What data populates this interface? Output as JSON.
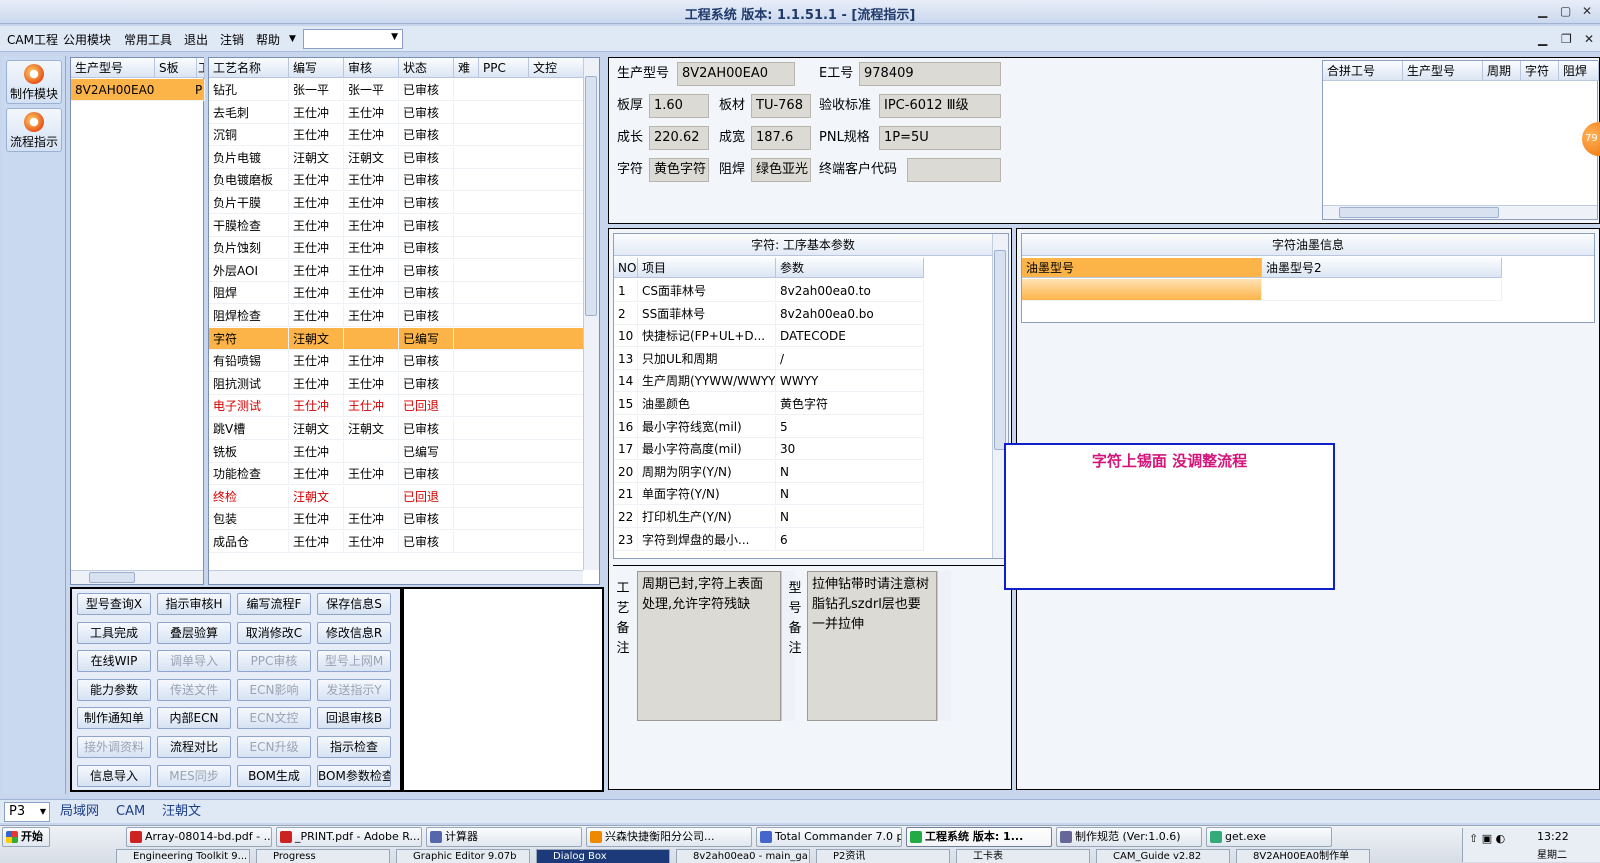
{
  "window": {
    "title": "工程系统  版本: 1.1.51.1 - [流程指示]"
  },
  "menu": {
    "items": [
      "CAM工程",
      "公用模块",
      "常用工具",
      "退出",
      "注销",
      "帮助"
    ]
  },
  "leftbar": {
    "items": [
      "制作模块",
      "流程指示"
    ]
  },
  "model_list": {
    "headers": [
      "生产型号",
      "S板",
      "工"
    ],
    "rows": [
      {
        "model": "8V2AH00EA0",
        "flag": "P"
      }
    ]
  },
  "process": {
    "headers": [
      "工艺名称",
      "编写",
      "审核",
      "状态",
      "难",
      "PPC",
      "文控"
    ],
    "rows": [
      {
        "name": "钻孔",
        "writer": "张一平",
        "reviewer": "张一平",
        "status": "已审核"
      },
      {
        "name": "去毛刺",
        "writer": "王仕冲",
        "reviewer": "王仕冲",
        "status": "已审核"
      },
      {
        "name": "沉铜",
        "writer": "王仕冲",
        "reviewer": "王仕冲",
        "status": "已审核"
      },
      {
        "name": "负片电镀",
        "writer": "汪朝文",
        "reviewer": "汪朝文",
        "status": "已审核"
      },
      {
        "name": "负电镀磨板",
        "writer": "王仕冲",
        "reviewer": "王仕冲",
        "status": "已审核"
      },
      {
        "name": "负片干膜",
        "writer": "王仕冲",
        "reviewer": "王仕冲",
        "status": "已审核"
      },
      {
        "name": "干膜检查",
        "writer": "王仕冲",
        "reviewer": "王仕冲",
        "status": "已审核"
      },
      {
        "name": "负片蚀刻",
        "writer": "王仕冲",
        "reviewer": "王仕冲",
        "status": "已审核"
      },
      {
        "name": "外层AOI",
        "writer": "王仕冲",
        "reviewer": "王仕冲",
        "status": "已审核"
      },
      {
        "name": "阻焊",
        "writer": "王仕冲",
        "reviewer": "王仕冲",
        "status": "已审核"
      },
      {
        "name": "阻焊检查",
        "writer": "王仕冲",
        "reviewer": "王仕冲",
        "status": "已审核"
      },
      {
        "name": "字符",
        "writer": "汪朝文",
        "reviewer": "",
        "status": "已编写"
      },
      {
        "name": "有铅喷锡",
        "writer": "王仕冲",
        "reviewer": "王仕冲",
        "status": "已审核"
      },
      {
        "name": "阻抗测试",
        "writer": "王仕冲",
        "reviewer": "王仕冲",
        "status": "已审核"
      },
      {
        "name": "电子测试",
        "writer": "王仕冲",
        "reviewer": "王仕冲",
        "status": "已回退"
      },
      {
        "name": "跳V槽",
        "writer": "汪朝文",
        "reviewer": "汪朝文",
        "status": "已审核"
      },
      {
        "name": "铣板",
        "writer": "王仕冲",
        "reviewer": "",
        "status": "已编写"
      },
      {
        "name": "功能检查",
        "writer": "王仕冲",
        "reviewer": "王仕冲",
        "status": "已审核"
      },
      {
        "name": "终检",
        "writer": "汪朝文",
        "reviewer": "",
        "status": "已回退"
      },
      {
        "name": "包装",
        "writer": "王仕冲",
        "reviewer": "王仕冲",
        "status": "已审核"
      },
      {
        "name": "成品仓",
        "writer": "王仕冲",
        "reviewer": "王仕冲",
        "status": "已审核"
      }
    ]
  },
  "actions": [
    [
      {
        "label": "型号查询X",
        "enabled": true
      },
      {
        "label": "指示审核H",
        "enabled": true
      },
      {
        "label": "编写流程F",
        "enabled": true
      },
      {
        "label": "保存信息S",
        "enabled": true
      }
    ],
    [
      {
        "label": "工具完成",
        "enabled": true
      },
      {
        "label": "叠层验算",
        "enabled": true
      },
      {
        "label": "取消修改C",
        "enabled": true
      },
      {
        "label": "修改信息R",
        "enabled": true
      }
    ],
    [
      {
        "label": "在线WIP",
        "enabled": true
      },
      {
        "label": "调单导入",
        "enabled": false
      },
      {
        "label": "PPC审核",
        "enabled": false
      },
      {
        "label": "型号上网M",
        "enabled": false
      }
    ],
    [
      {
        "label": "能力参数",
        "enabled": true
      },
      {
        "label": "传送文件",
        "enabled": false
      },
      {
        "label": "ECN影响",
        "enabled": false
      },
      {
        "label": "发送指示Y",
        "enabled": false
      }
    ],
    [
      {
        "label": "制作通知单",
        "enabled": true
      },
      {
        "label": "内部ECN",
        "enabled": true
      },
      {
        "label": "ECN文控",
        "enabled": false
      },
      {
        "label": "回退审核B",
        "enabled": true
      }
    ],
    [
      {
        "label": "接外调资料",
        "enabled": false
      },
      {
        "label": "流程对比",
        "enabled": true
      },
      {
        "label": "ECN升级",
        "enabled": false
      },
      {
        "label": "指示检查",
        "enabled": true
      }
    ],
    [
      {
        "label": "信息导入",
        "enabled": true
      },
      {
        "label": "MES同步",
        "enabled": false
      },
      {
        "label": "BOM生成",
        "enabled": true
      },
      {
        "label": "BOM参数检查",
        "enabled": true
      }
    ]
  ],
  "info": {
    "model_label": "生产型号",
    "model": "8V2AH00EA0",
    "eno_label": "E工号",
    "eno": "978409",
    "thick_label": "板厚",
    "thick": "1.60",
    "material_label": "板材",
    "material": "TU-768",
    "std_label": "验收标准",
    "std": "IPC-6012 Ⅲ级",
    "len_label": "成长",
    "len": "220.62",
    "wid_label": "成宽",
    "wid": "187.6",
    "pnl_label": "PNL规格",
    "pnl": "1P=5U",
    "char_label": "字符",
    "char": "黄色字符",
    "mask_label": "阻焊",
    "mask": "绿色亚光",
    "cust_label": "终端客户代码",
    "cust": ""
  },
  "merge": {
    "headers": [
      "合拼工号",
      "生产型号",
      "周期",
      "字符",
      "阻焊"
    ]
  },
  "badge": "79",
  "params": {
    "title": "字符: 工序基本参数",
    "headers": [
      "NO",
      "项目",
      "参数"
    ],
    "rows": [
      {
        "no": "1",
        "item": "CS面菲林号",
        "val": "8v2ah00ea0.to"
      },
      {
        "no": "2",
        "item": "SS面菲林号",
        "val": "8v2ah00ea0.bo"
      },
      {
        "no": "10",
        "item": "快捷标记(FP+UL+D...",
        "val": "DATECODE"
      },
      {
        "no": "13",
        "item": "只加UL和周期",
        "val": "/"
      },
      {
        "no": "14",
        "item": "生产周期(YYWW/WWYY)",
        "val": "WWYY"
      },
      {
        "no": "15",
        "item": "油墨颜色",
        "val": "黄色字符"
      },
      {
        "no": "16",
        "item": "最小字符线宽(mil)",
        "val": "5"
      },
      {
        "no": "17",
        "item": "最小字符高度(mil)",
        "val": "30"
      },
      {
        "no": "20",
        "item": "周期为阴字(Y/N)",
        "val": "N"
      },
      {
        "no": "21",
        "item": "单面字符(Y/N)",
        "val": "N"
      },
      {
        "no": "22",
        "item": "打印机生产(Y/N)",
        "val": "N"
      },
      {
        "no": "23",
        "item": "字符到焊盘的最小...",
        "val": "6"
      }
    ]
  },
  "ink": {
    "title": "字符油墨信息",
    "headers": [
      "油墨型号",
      "油墨型号2"
    ]
  },
  "note": {
    "text": "字符上锡面   没调整流程"
  },
  "remarks": {
    "process_label": "工艺备注",
    "process_text": "周期已封,字符上表面处理,允许字符残缺",
    "model_label": "型号备注",
    "model_text": "拉伸钻带时请注意树脂钻孔szdrl层也要一并拉伸"
  },
  "status": {
    "combo": "P3",
    "tabs": [
      "局域网",
      "CAM",
      "汪朝文"
    ]
  },
  "taskbar": {
    "start": "开始",
    "row1": [
      "Array-08014-bd.pdf - ...",
      "_PRINT.pdf - Adobe R...",
      "计算器",
      "兴森快捷衡阳分公司...",
      "Total Commander 7.0 p...",
      "工程系统  版本: 1...",
      "制作规范 (Ver:1.0.6)",
      "get.exe"
    ],
    "row2": [
      "Engineering Toolkit 9...",
      "Progress",
      "Graphic Editor 9.07b",
      "Dialog Box",
      "8v2ah00ea0 - main_ga...",
      "P2资讯",
      "工卡表",
      "CAM_Guide v2.82",
      "8V2AH00EA0制作单"
    ],
    "time": "13:22",
    "day": "星期二"
  },
  "colors": {
    "selected_row": "#fcb449",
    "rejected": "#d40000",
    "note_border": "#1020c8",
    "note_text": "#d4147a"
  }
}
